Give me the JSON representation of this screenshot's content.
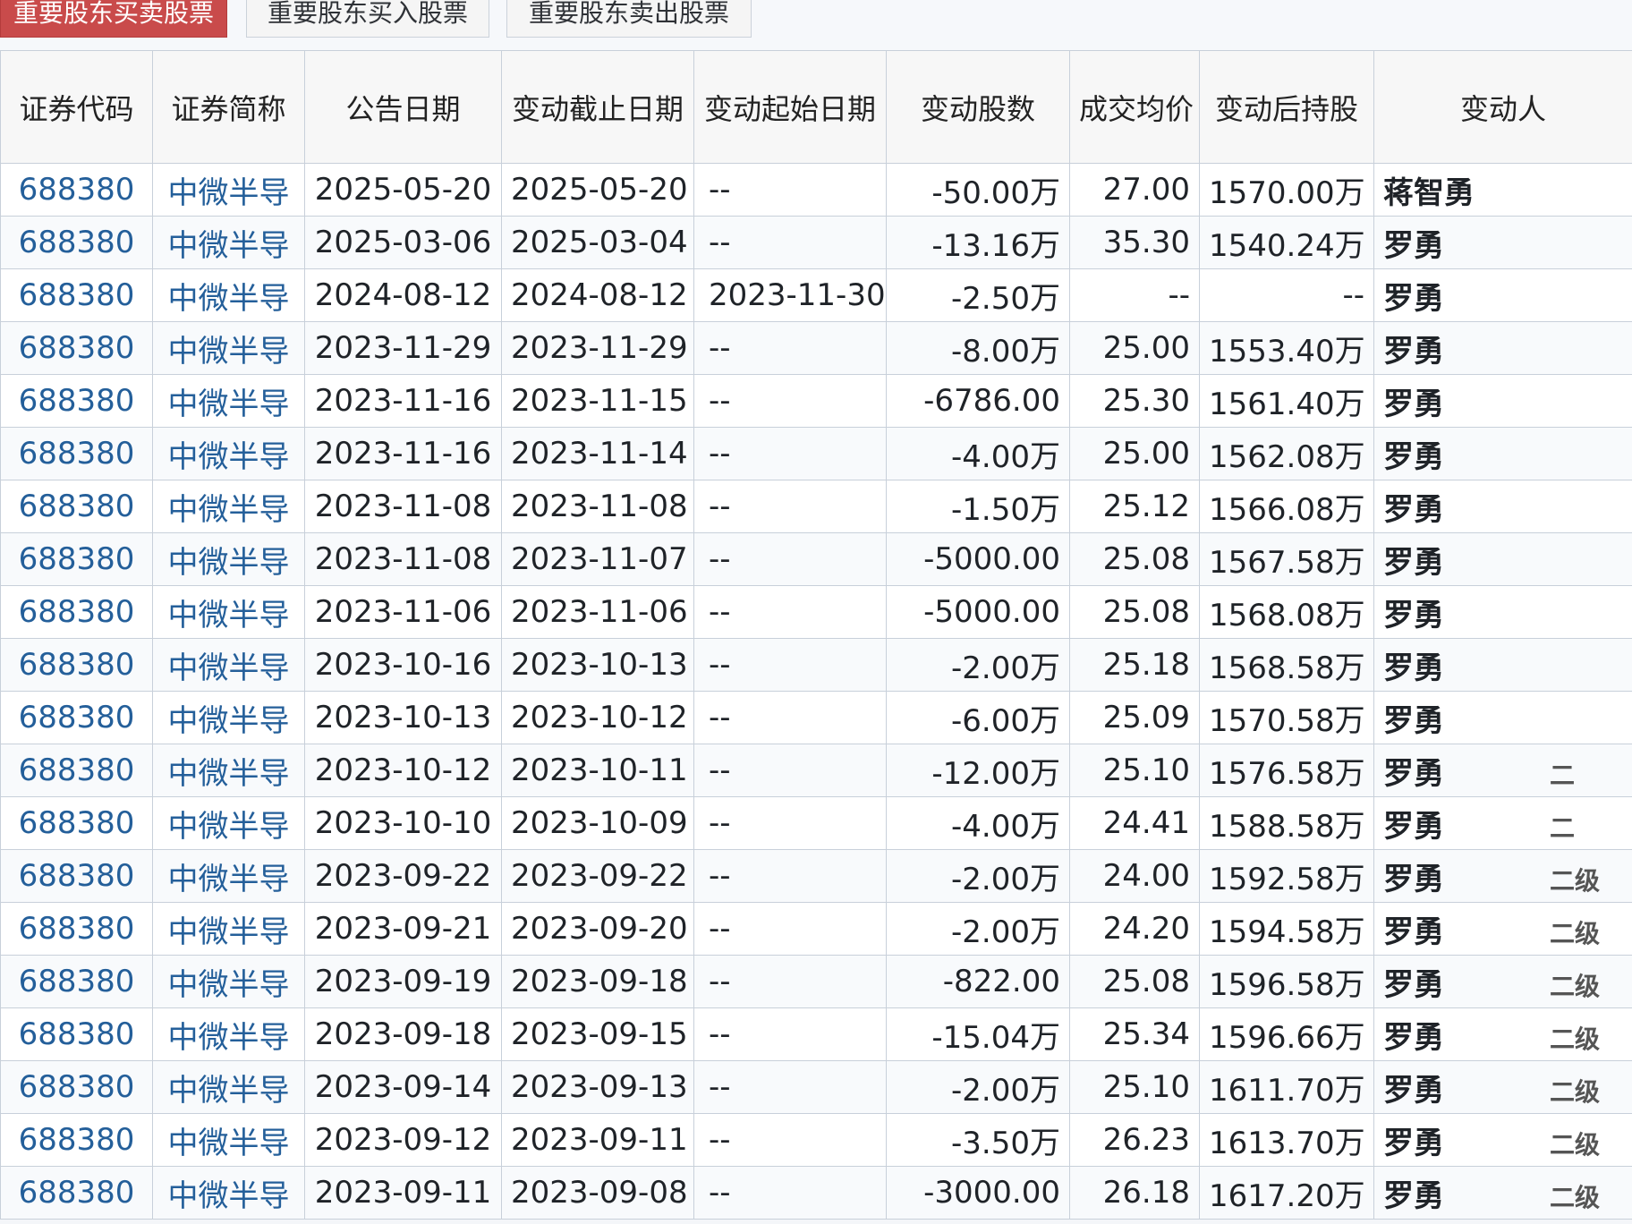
{
  "tabs": [
    {
      "label": "重要股东买卖股票",
      "active": true
    },
    {
      "label": "重要股东买入股票",
      "active": false
    },
    {
      "label": "重要股东卖出股票",
      "active": false
    }
  ],
  "table": {
    "columns": [
      "证券代码",
      "证券简称",
      "公告日期",
      "变动截止日期",
      "变动起始日期",
      "变动股数",
      "成交均价",
      "变动后持股",
      "变动人"
    ],
    "rows": [
      {
        "code": "688380",
        "name": "中微半导",
        "notice_date": "2025-05-20",
        "end_date": "2025-05-20",
        "start_date": "--",
        "shares": "-50.00万",
        "price": "27.00",
        "after": "1570.00万",
        "holder": "蒋智勇",
        "extra": ""
      },
      {
        "code": "688380",
        "name": "中微半导",
        "notice_date": "2025-03-06",
        "end_date": "2025-03-04",
        "start_date": "--",
        "shares": "-13.16万",
        "price": "35.30",
        "after": "1540.24万",
        "holder": "罗勇",
        "extra": ""
      },
      {
        "code": "688380",
        "name": "中微半导",
        "notice_date": "2024-08-12",
        "end_date": "2024-08-12",
        "start_date": "2023-11-30",
        "shares": "-2.50万",
        "price": "--",
        "after": "--",
        "holder": "罗勇",
        "extra": ""
      },
      {
        "code": "688380",
        "name": "中微半导",
        "notice_date": "2023-11-29",
        "end_date": "2023-11-29",
        "start_date": "--",
        "shares": "-8.00万",
        "price": "25.00",
        "after": "1553.40万",
        "holder": "罗勇",
        "extra": ""
      },
      {
        "code": "688380",
        "name": "中微半导",
        "notice_date": "2023-11-16",
        "end_date": "2023-11-15",
        "start_date": "--",
        "shares": "-6786.00",
        "price": "25.30",
        "after": "1561.40万",
        "holder": "罗勇",
        "extra": ""
      },
      {
        "code": "688380",
        "name": "中微半导",
        "notice_date": "2023-11-16",
        "end_date": "2023-11-14",
        "start_date": "--",
        "shares": "-4.00万",
        "price": "25.00",
        "after": "1562.08万",
        "holder": "罗勇",
        "extra": ""
      },
      {
        "code": "688380",
        "name": "中微半导",
        "notice_date": "2023-11-08",
        "end_date": "2023-11-08",
        "start_date": "--",
        "shares": "-1.50万",
        "price": "25.12",
        "after": "1566.08万",
        "holder": "罗勇",
        "extra": ""
      },
      {
        "code": "688380",
        "name": "中微半导",
        "notice_date": "2023-11-08",
        "end_date": "2023-11-07",
        "start_date": "--",
        "shares": "-5000.00",
        "price": "25.08",
        "after": "1567.58万",
        "holder": "罗勇",
        "extra": ""
      },
      {
        "code": "688380",
        "name": "中微半导",
        "notice_date": "2023-11-06",
        "end_date": "2023-11-06",
        "start_date": "--",
        "shares": "-5000.00",
        "price": "25.08",
        "after": "1568.08万",
        "holder": "罗勇",
        "extra": ""
      },
      {
        "code": "688380",
        "name": "中微半导",
        "notice_date": "2023-10-16",
        "end_date": "2023-10-13",
        "start_date": "--",
        "shares": "-2.00万",
        "price": "25.18",
        "after": "1568.58万",
        "holder": "罗勇",
        "extra": ""
      },
      {
        "code": "688380",
        "name": "中微半导",
        "notice_date": "2023-10-13",
        "end_date": "2023-10-12",
        "start_date": "--",
        "shares": "-6.00万",
        "price": "25.09",
        "after": "1570.58万",
        "holder": "罗勇",
        "extra": ""
      },
      {
        "code": "688380",
        "name": "中微半导",
        "notice_date": "2023-10-12",
        "end_date": "2023-10-11",
        "start_date": "--",
        "shares": "-12.00万",
        "price": "25.10",
        "after": "1576.58万",
        "holder": "罗勇",
        "extra": "二"
      },
      {
        "code": "688380",
        "name": "中微半导",
        "notice_date": "2023-10-10",
        "end_date": "2023-10-09",
        "start_date": "--",
        "shares": "-4.00万",
        "price": "24.41",
        "after": "1588.58万",
        "holder": "罗勇",
        "extra": "二"
      },
      {
        "code": "688380",
        "name": "中微半导",
        "notice_date": "2023-09-22",
        "end_date": "2023-09-22",
        "start_date": "--",
        "shares": "-2.00万",
        "price": "24.00",
        "after": "1592.58万",
        "holder": "罗勇",
        "extra": "二级"
      },
      {
        "code": "688380",
        "name": "中微半导",
        "notice_date": "2023-09-21",
        "end_date": "2023-09-20",
        "start_date": "--",
        "shares": "-2.00万",
        "price": "24.20",
        "after": "1594.58万",
        "holder": "罗勇",
        "extra": "二级"
      },
      {
        "code": "688380",
        "name": "中微半导",
        "notice_date": "2023-09-19",
        "end_date": "2023-09-18",
        "start_date": "--",
        "shares": "-822.00",
        "price": "25.08",
        "after": "1596.58万",
        "holder": "罗勇",
        "extra": "二级"
      },
      {
        "code": "688380",
        "name": "中微半导",
        "notice_date": "2023-09-18",
        "end_date": "2023-09-15",
        "start_date": "--",
        "shares": "-15.04万",
        "price": "25.34",
        "after": "1596.66万",
        "holder": "罗勇",
        "extra": "二级"
      },
      {
        "code": "688380",
        "name": "中微半导",
        "notice_date": "2023-09-14",
        "end_date": "2023-09-13",
        "start_date": "--",
        "shares": "-2.00万",
        "price": "25.10",
        "after": "1611.70万",
        "holder": "罗勇",
        "extra": "二级"
      },
      {
        "code": "688380",
        "name": "中微半导",
        "notice_date": "2023-09-12",
        "end_date": "2023-09-11",
        "start_date": "--",
        "shares": "-3.50万",
        "price": "26.23",
        "after": "1613.70万",
        "holder": "罗勇",
        "extra": "二级"
      },
      {
        "code": "688380",
        "name": "中微半导",
        "notice_date": "2023-09-11",
        "end_date": "2023-09-08",
        "start_date": "--",
        "shares": "-3000.00",
        "price": "26.18",
        "after": "1617.20万",
        "holder": "罗勇",
        "extra": "二级"
      }
    ]
  }
}
